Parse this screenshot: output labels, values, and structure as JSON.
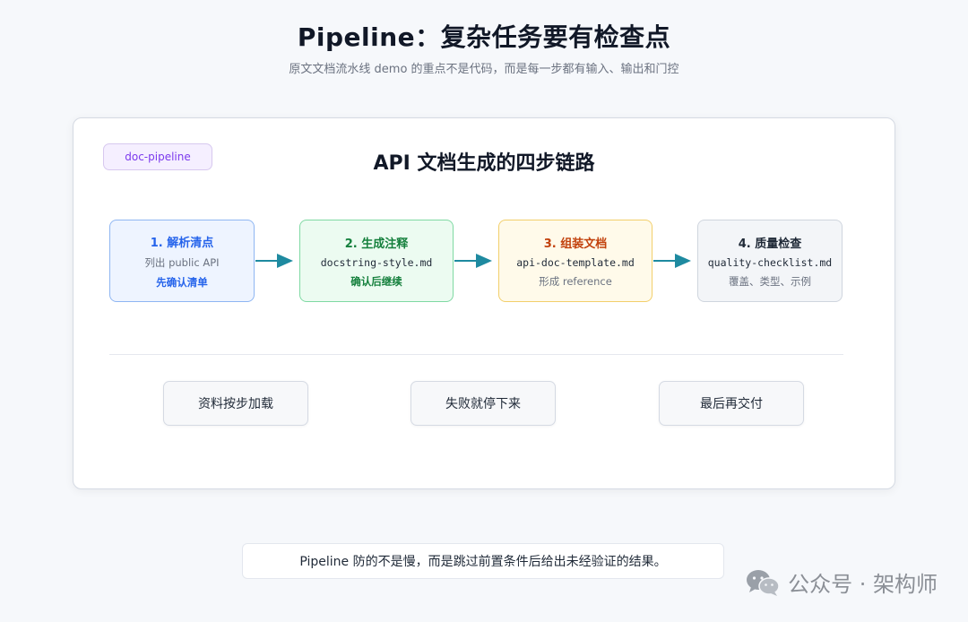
{
  "header": {
    "title": "Pipeline：复杂任务要有检查点",
    "subtitle": "原文文档流水线 demo 的重点不是代码，而是每一步都有输入、输出和门控"
  },
  "card": {
    "tag": "doc-pipeline",
    "title": "API 文档生成的四步链路",
    "steps": [
      {
        "title": "1. 解析清点",
        "middle": "列出 public API",
        "bottom": "先确认清单"
      },
      {
        "title": "2. 生成注释",
        "middle": "docstring-style.md",
        "bottom": "确认后继续"
      },
      {
        "title": "3. 组装文档",
        "middle": "api-doc-template.md",
        "bottom": "形成 reference"
      },
      {
        "title": "4. 质量检查",
        "middle": "quality-checklist.md",
        "bottom": "覆盖、类型、示例"
      }
    ],
    "principles": [
      "资料按步加载",
      "失败就停下来",
      "最后再交付"
    ]
  },
  "footer": {
    "note": "Pipeline 防的不是慢，而是跳过前置条件后给出未经验证的结果。"
  },
  "watermark": {
    "text": "公众号 · 架构师",
    "icon": "wechat-icon"
  },
  "colors": {
    "arrow": "#1e8aa0",
    "tag": "#7c3aed",
    "step1": "#2563eb",
    "step2": "#15803d",
    "step3": "#c2410c"
  }
}
